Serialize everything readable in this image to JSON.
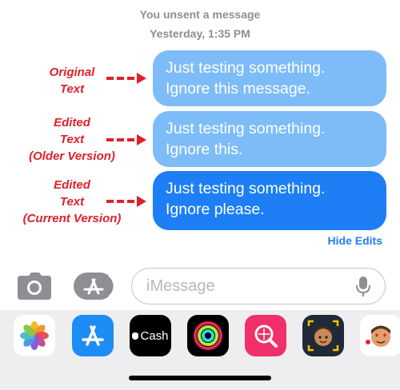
{
  "thread": {
    "unsent_notice": "You unsent a message",
    "timestamp": "Yesterday, 1:35 PM"
  },
  "annotations": [
    {
      "lines": [
        "Original",
        "Text"
      ]
    },
    {
      "lines": [
        "Edited",
        "Text",
        "(Older Version)"
      ]
    },
    {
      "lines": [
        "Edited",
        "Text",
        "(Current Version)"
      ]
    }
  ],
  "messages": [
    {
      "lines": [
        "Just testing something.",
        "Ignore this message."
      ],
      "state": "original"
    },
    {
      "lines": [
        "Just testing something.",
        "Ignore this."
      ],
      "state": "older"
    },
    {
      "lines": [
        "Just testing something.",
        "Ignore please."
      ],
      "state": "current"
    }
  ],
  "hide_edits_label": "Hide Edits",
  "compose": {
    "placeholder": "iMessage",
    "camera_icon": "camera-icon",
    "apps_icon": "app-store-icon",
    "mic_icon": "microphone-icon"
  },
  "app_drawer": [
    {
      "name": "photos",
      "icon": "photos-icon"
    },
    {
      "name": "app-store",
      "icon": "app-store-icon"
    },
    {
      "name": "cash",
      "icon": "apple-cash-icon",
      "label": "Cash"
    },
    {
      "name": "activity",
      "icon": "activity-rings-icon"
    },
    {
      "name": "image-search",
      "icon": "image-search-icon"
    },
    {
      "name": "memoji",
      "icon": "memoji-icon"
    },
    {
      "name": "memoji-stickers",
      "icon": "memoji-stickers-icon"
    }
  ],
  "colors": {
    "bubble_old": "#7dbcf9",
    "bubble_current": "#1d7ef5",
    "annotation": "#e0202a",
    "meta_gray": "#8e8e93"
  }
}
